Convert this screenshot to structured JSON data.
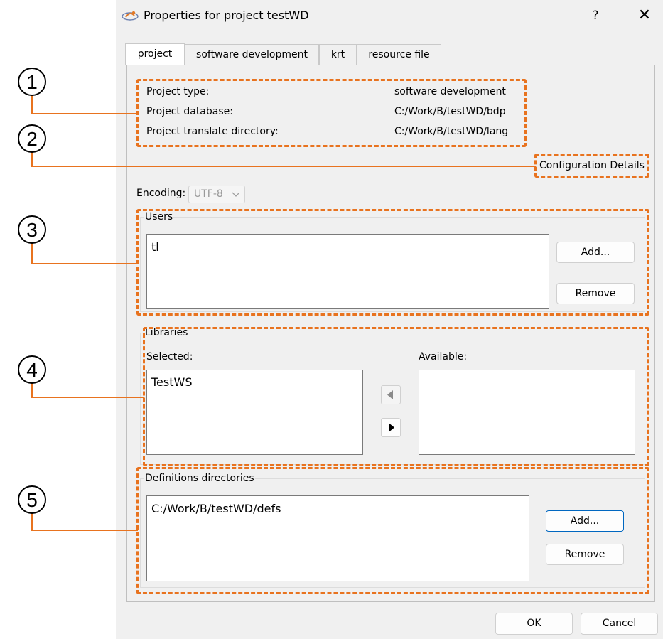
{
  "window": {
    "title": "Properties for project testWD",
    "help_glyph": "?",
    "close_glyph": "✕"
  },
  "tabs": [
    {
      "label": "project",
      "active": true
    },
    {
      "label": "software development",
      "active": false
    },
    {
      "label": "krt",
      "active": false
    },
    {
      "label": "resource file",
      "active": false
    }
  ],
  "project_info": {
    "type_label": "Project type:",
    "type_value": "software development",
    "database_label": "Project database:",
    "database_value": "C:/Work/B/testWD/bdp",
    "translate_label": "Project translate directory:",
    "translate_value": "C:/Work/B/testWD/lang"
  },
  "config_button": "Configuration Details",
  "encoding": {
    "label": "Encoding:",
    "value": "UTF-8"
  },
  "users": {
    "title": "Users",
    "items": [
      "tl"
    ],
    "add": "Add...",
    "remove": "Remove"
  },
  "libraries": {
    "title": "Libraries",
    "selected_label": "Selected:",
    "available_label": "Available:",
    "selected_items": [
      "TestWS"
    ],
    "available_items": []
  },
  "definitions": {
    "title": "Definitions directories",
    "items": [
      "C:/Work/B/testWD/defs"
    ],
    "add": "Add...",
    "remove": "Remove"
  },
  "footer": {
    "ok": "OK",
    "cancel": "Cancel"
  },
  "callouts": [
    "1",
    "2",
    "3",
    "4",
    "5"
  ],
  "colors": {
    "callout_orange": "#e8731f",
    "dialog_background": "#f0f0f0",
    "focus_blue": "#0067c0"
  },
  "icons": {
    "app": "app-logo-icon",
    "prev": "triangle-left-icon",
    "next": "triangle-right-icon",
    "dropdown": "chevron-down-icon"
  }
}
